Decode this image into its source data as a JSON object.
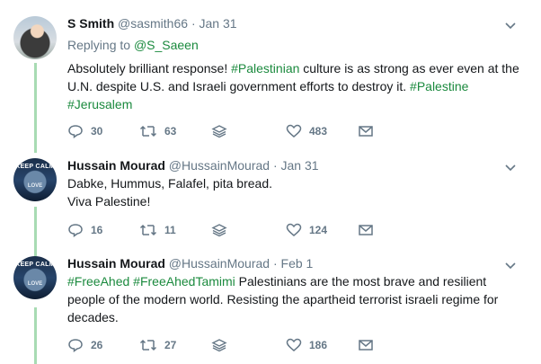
{
  "tweets": [
    {
      "name": "S Smith",
      "handle": "@sasmith66",
      "dot": "·",
      "date": "Jan 31",
      "reply_prefix": "Replying to ",
      "reply_to": "@S_Saeen",
      "text_parts": [
        "Absolutely brilliant response! ",
        "#Palestinian",
        " culture is as strong as ever even at the U.N. despite U.S. and Israeli government efforts to destroy it. ",
        "#Palestine",
        "#Jerusalem"
      ],
      "replies": "30",
      "retweets": "63",
      "likes": "483",
      "avatar_icon": "profile-photo"
    },
    {
      "name": "Hussain Mourad",
      "handle": "@HussainMourad",
      "dot": "·",
      "date": "Jan 31",
      "text_line1": "Dabke, Hummus, Falafel, pita bread.",
      "text_line2": "Viva Palestine!",
      "replies": "16",
      "retweets": "11",
      "likes": "124",
      "avatar_text": "KEEP CALM",
      "avatar_text2": "LOVE"
    },
    {
      "name": "Hussain Mourad",
      "handle": "@HussainMourad",
      "dot": "·",
      "date": "Feb 1",
      "text_parts": [
        "#FreeAhed",
        "#FreeAhedTamimi",
        " Palestinians are the most brave and resilient people of the modern world. Resisting the apartheid terrorist israeli regime for decades."
      ],
      "replies": "26",
      "retweets": "27",
      "likes": "186",
      "avatar_text": "KEEP CALM",
      "avatar_text2": "LOVE"
    }
  ],
  "colors": {
    "link": "#1b8a3e",
    "thread_line": "#a8dbb3",
    "muted": "#657786"
  }
}
